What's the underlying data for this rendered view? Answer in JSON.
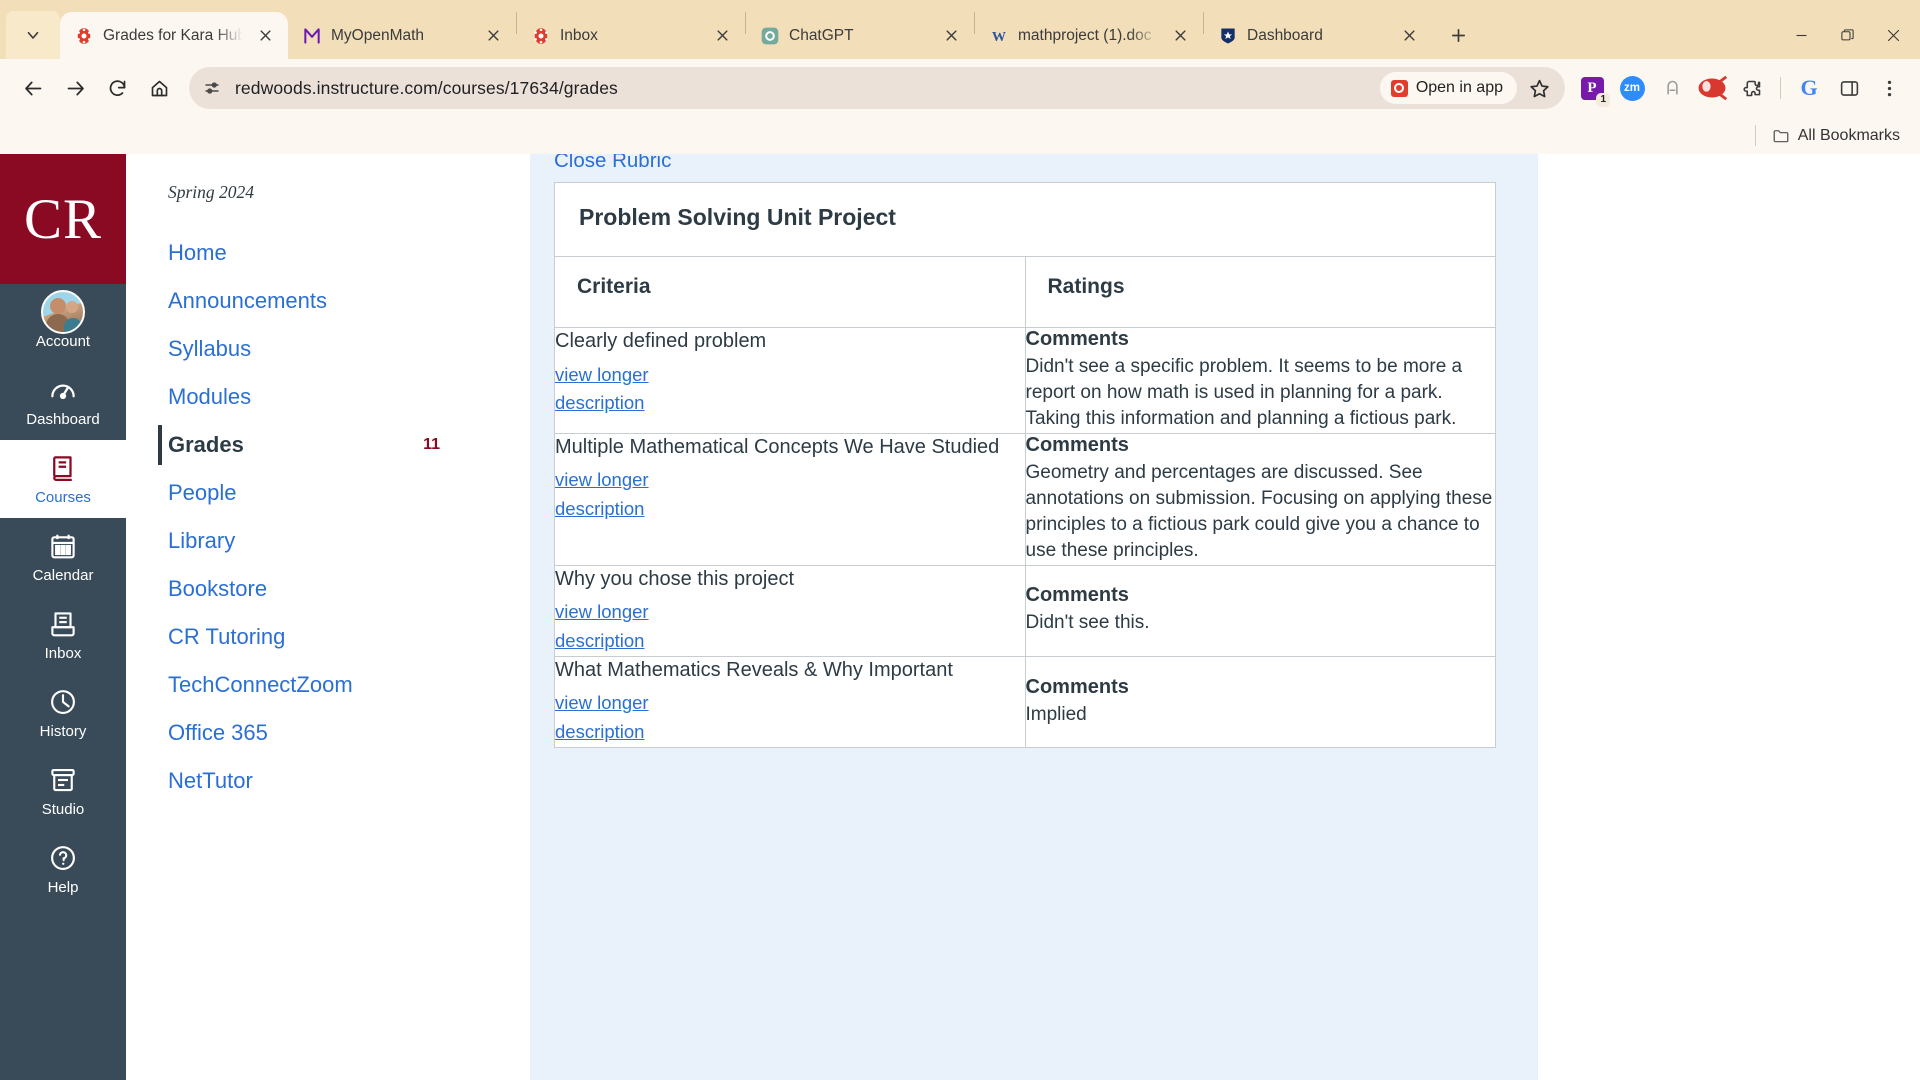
{
  "browser": {
    "tabs": [
      {
        "title": "Grades for Kara Hub",
        "icon": "canvas-icon",
        "active": true
      },
      {
        "title": "MyOpenMath",
        "icon": "myopenmath-icon",
        "active": false
      },
      {
        "title": "Inbox",
        "icon": "canvas-icon",
        "active": false
      },
      {
        "title": "ChatGPT",
        "icon": "chatgpt-icon",
        "active": false
      },
      {
        "title": "mathproject (1).doc",
        "icon": "word-icon",
        "active": false
      },
      {
        "title": "Dashboard",
        "icon": "star-shield-icon",
        "active": false
      }
    ],
    "new_tab_label": "+",
    "url": "redwoods.instructure.com/courses/17634/grades",
    "open_in_app_label": "Open in app",
    "all_bookmarks_label": "All Bookmarks",
    "extensions": [
      {
        "name": "powerpoint-extension",
        "label": "P",
        "badge": "1"
      },
      {
        "name": "zoom-extension",
        "label": "zm"
      },
      {
        "name": "grammarly-extension",
        "label": ""
      },
      {
        "name": "honey-extension",
        "label": ""
      },
      {
        "name": "puzzle-extension",
        "label": ""
      },
      {
        "name": "google-extension",
        "label": "G"
      },
      {
        "name": "side-panel-extension",
        "label": ""
      },
      {
        "name": "chrome-menu",
        "label": ""
      }
    ]
  },
  "global_nav": {
    "logo_text": "CR",
    "items": [
      {
        "label": "Account",
        "icon": "avatar-icon",
        "active": false
      },
      {
        "label": "Dashboard",
        "icon": "dashboard-icon",
        "active": false
      },
      {
        "label": "Courses",
        "icon": "courses-book-icon",
        "active": true
      },
      {
        "label": "Calendar",
        "icon": "calendar-icon",
        "active": false
      },
      {
        "label": "Inbox",
        "icon": "inbox-tray-icon",
        "active": false
      },
      {
        "label": "History",
        "icon": "clock-icon",
        "active": false
      },
      {
        "label": "Studio",
        "icon": "studio-video-icon",
        "active": false
      },
      {
        "label": "Help",
        "icon": "help-question-icon",
        "active": false
      }
    ]
  },
  "course_nav": {
    "term": "Spring 2024",
    "items": [
      {
        "label": "Home",
        "active": false,
        "badge": ""
      },
      {
        "label": "Announcements",
        "active": false,
        "badge": ""
      },
      {
        "label": "Syllabus",
        "active": false,
        "badge": ""
      },
      {
        "label": "Modules",
        "active": false,
        "badge": ""
      },
      {
        "label": "Grades",
        "active": true,
        "badge": "11"
      },
      {
        "label": "People",
        "active": false,
        "badge": ""
      },
      {
        "label": "Library",
        "active": false,
        "badge": ""
      },
      {
        "label": "Bookstore",
        "active": false,
        "badge": ""
      },
      {
        "label": "CR Tutoring",
        "active": false,
        "badge": ""
      },
      {
        "label": "TechConnectZoom",
        "active": false,
        "badge": ""
      },
      {
        "label": "Office 365",
        "active": false,
        "badge": ""
      },
      {
        "label": "NetTutor",
        "active": false,
        "badge": ""
      }
    ]
  },
  "rubric": {
    "close_link": "Close Rubric",
    "title": "Problem Solving Unit Project",
    "col_criteria": "Criteria",
    "col_ratings": "Ratings",
    "view_longer_line1": "view longer",
    "view_longer_line2": "description",
    "comments_label": "Comments",
    "rows": [
      {
        "criterion": "Clearly defined problem",
        "comments_label": "Comments",
        "comment": "Didn't see a specific problem. It seems to be more a report on how math is used in planning for a park. Taking this information and planning a fictious park."
      },
      {
        "criterion": "Multiple Mathematical Concepts We Have Studied",
        "comments_label": "Comments",
        "comment": "Geometry and percentages are discussed. See annotations on submission. Focusing on applying these principles to a fictious park could give you a chance to use these principles."
      },
      {
        "criterion": "Why you chose this project",
        "comments_label": "Comments",
        "comment": "Didn't see this."
      },
      {
        "criterion": "What Mathematics Reveals & Why Important",
        "comments_label": "Comments",
        "comment": "Implied"
      }
    ]
  }
}
